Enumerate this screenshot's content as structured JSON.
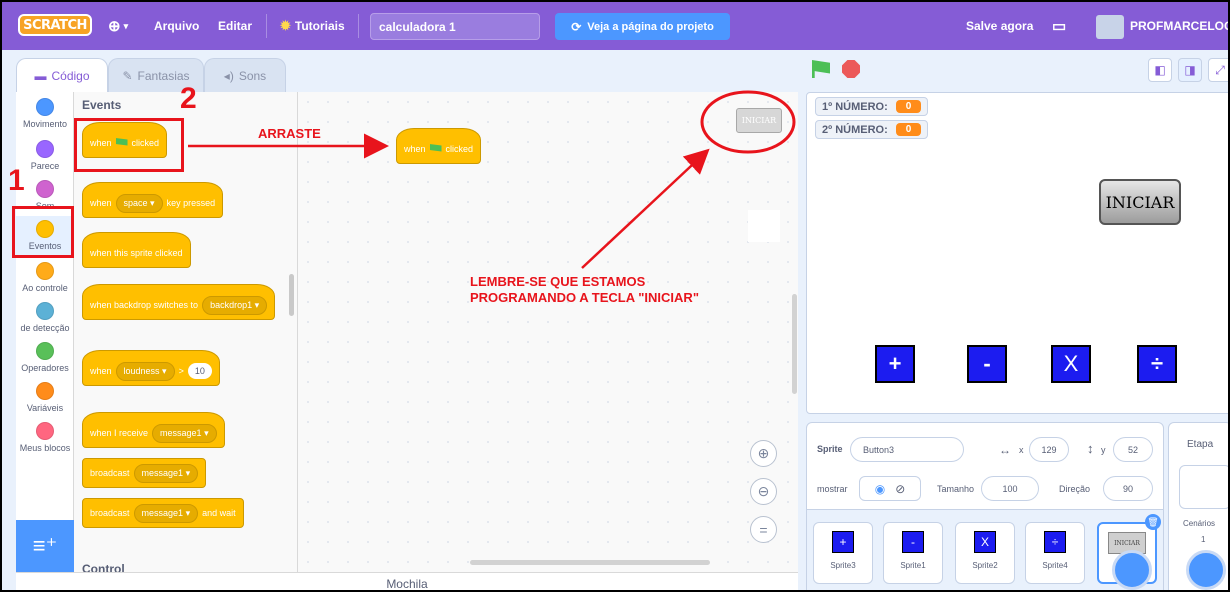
{
  "menubar": {
    "logo": "SCRATCH",
    "language_icon": "globe-icon",
    "file": "Arquivo",
    "edit": "Editar",
    "tutorials": "Tutoriais",
    "project_title": "calculadora 1",
    "see_project": "Veja a página do projeto",
    "save_now": "Salve agora",
    "username": "PROFMARCELOG",
    "color": "#855cd6"
  },
  "tabs": [
    {
      "label": "Código",
      "icon": "code-icon"
    },
    {
      "label": "Fantasias",
      "icon": "brush-icon"
    },
    {
      "label": "Sons",
      "icon": "speaker-icon"
    }
  ],
  "categories": [
    {
      "label": "Movimento",
      "color": "#4c97ff"
    },
    {
      "label": "Parece",
      "color": "#9966ff"
    },
    {
      "label": "Som",
      "color": "#cf63cf"
    },
    {
      "label": "Eventos",
      "color": "#ffbf00"
    },
    {
      "label": "Ao controle",
      "color": "#ffab19"
    },
    {
      "label": "de detecção",
      "color": "#5cb1d6"
    },
    {
      "label": "Operadores",
      "color": "#59c059"
    },
    {
      "label": "Variáveis",
      "color": "#ff8c1a"
    },
    {
      "label": "Meus blocos",
      "color": "#ff6680"
    }
  ],
  "palette": {
    "title": "Events",
    "next_title": "Control",
    "blocks": {
      "flag_when": "when",
      "flag_clicked": "clicked",
      "key_when": "when",
      "key_value": "space",
      "key_pressed": "key pressed",
      "sprite_clicked": "when this sprite clicked",
      "backdrop_when": "when backdrop switches to",
      "backdrop_value": "backdrop1",
      "loudness_when": "when",
      "loudness_value": "loudness",
      "loudness_gt": ">",
      "loudness_num": "10",
      "receive_when": "when I receive",
      "receive_value": "message1",
      "broadcast": "broadcast",
      "broadcast_value": "message1",
      "broadcast_wait": "broadcast",
      "broadcast_wait_value": "message1",
      "and_wait": "and wait"
    }
  },
  "workspace": {
    "block_when": "when",
    "block_clicked": "clicked",
    "sprite_thumb": "INICIAR"
  },
  "backpack": "Mochila",
  "stage": {
    "monitors": [
      {
        "label": "1º NÚMERO:",
        "value": "0"
      },
      {
        "label": "2º NÚMERO:",
        "value": "0"
      }
    ],
    "iniciar_button": "INICIAR",
    "op_buttons": [
      "+",
      "-",
      "X",
      "÷"
    ]
  },
  "sprite_info": {
    "sprite_label": "Sprite",
    "sprite_name": "Button3",
    "x_label": "x",
    "x_value": "129",
    "y_label": "y",
    "y_value": "52",
    "show_label": "mostrar",
    "size_label": "Tamanho",
    "size_value": "100",
    "direction_label": "Direção",
    "direction_value": "90"
  },
  "sprites": [
    {
      "name": "Sprite3",
      "glyph": "+"
    },
    {
      "name": "Sprite1",
      "glyph": "-"
    },
    {
      "name": "Sprite2",
      "glyph": "X"
    },
    {
      "name": "Sprite4",
      "glyph": "÷"
    },
    {
      "name": "",
      "glyph": "INICIAR"
    }
  ],
  "stage_panel": {
    "title": "Etapa",
    "backdrops_label": "Cenários",
    "backdrops_count": "1"
  },
  "annotations": {
    "step1": "1",
    "step2": "2",
    "drag": "ARRASTE",
    "note_line1": "LEMBRE-SE QUE ESTAMOS",
    "note_line2": "PROGRAMANDO A TECLA \"INICIAR\"",
    "color": "#e8141c"
  }
}
